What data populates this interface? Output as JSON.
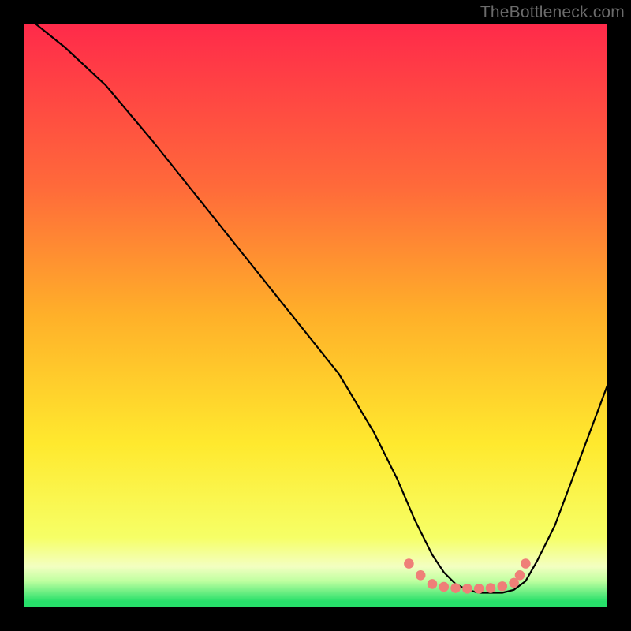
{
  "watermark": "TheBottleneck.com",
  "chart_data": {
    "type": "line",
    "title": "",
    "xlabel": "",
    "ylabel": "",
    "xlim": [
      0,
      100
    ],
    "ylim": [
      0,
      100
    ],
    "grid": false,
    "legend": false,
    "background_gradient": {
      "stops": [
        {
          "pos": 0.0,
          "color": "#ff2a4a"
        },
        {
          "pos": 0.28,
          "color": "#ff6a3a"
        },
        {
          "pos": 0.5,
          "color": "#ffb029"
        },
        {
          "pos": 0.72,
          "color": "#ffe92e"
        },
        {
          "pos": 0.88,
          "color": "#f6ff66"
        },
        {
          "pos": 0.93,
          "color": "#f3ffc1"
        },
        {
          "pos": 0.955,
          "color": "#bfffa0"
        },
        {
          "pos": 0.99,
          "color": "#27e06a"
        }
      ]
    },
    "series": [
      {
        "name": "curve",
        "color": "#000000",
        "x": [
          2,
          7,
          14,
          22,
          30,
          38,
          46,
          54,
          60,
          64,
          67,
          70,
          72,
          74,
          76,
          78,
          80,
          82,
          84,
          86,
          88,
          91,
          94,
          97,
          100
        ],
        "y": [
          100,
          96,
          89.5,
          80,
          70,
          60,
          50,
          40,
          30,
          22,
          15,
          9,
          6,
          4,
          3,
          2.5,
          2.5,
          2.5,
          3,
          4.5,
          8,
          14,
          22,
          30,
          38
        ]
      },
      {
        "name": "optimum-band",
        "color": "#ef7f78",
        "style": "dotted-thick",
        "x": [
          66,
          68,
          70,
          72,
          74,
          76,
          78,
          80,
          82,
          84,
          85,
          86
        ],
        "y": [
          7.5,
          5.5,
          4,
          3.5,
          3.3,
          3.2,
          3.2,
          3.3,
          3.6,
          4.2,
          5.5,
          7.5
        ]
      }
    ]
  }
}
